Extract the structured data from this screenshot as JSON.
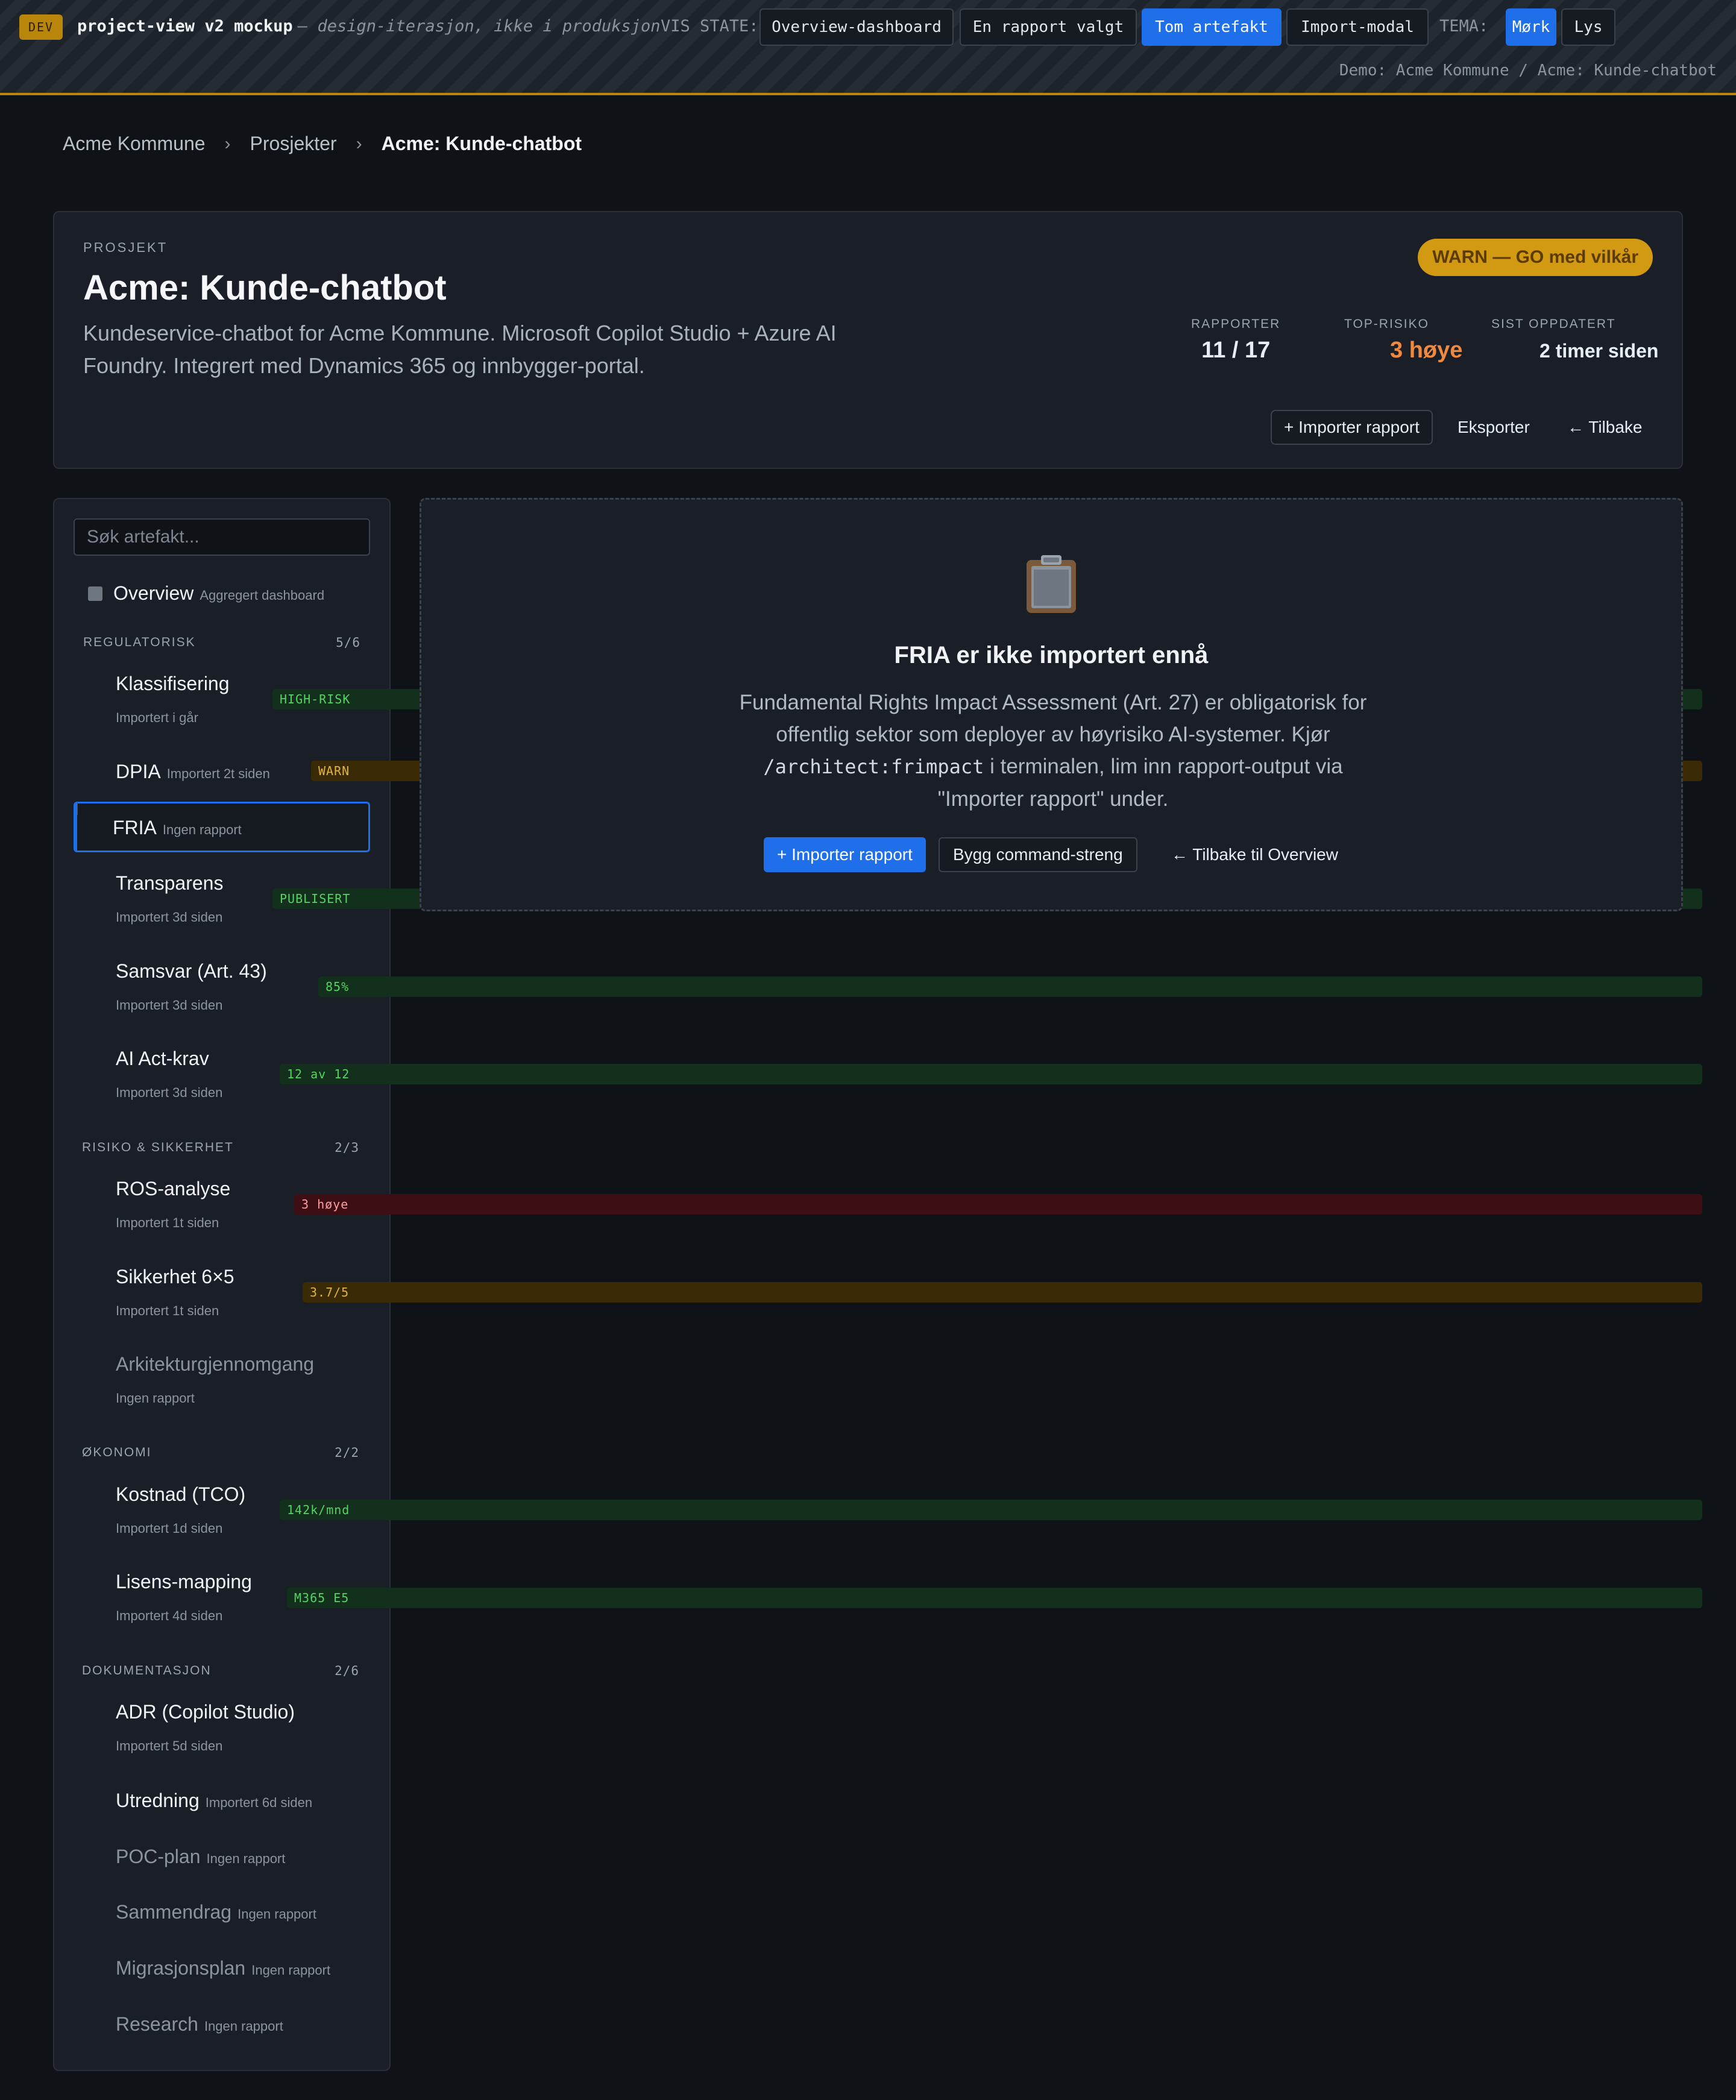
{
  "devbar": {
    "badge": "DEV",
    "title": "project-view v2 mockup",
    "subtitle": "— design-iterasjon, ikke i produksjon",
    "state_label": "VIS STATE:",
    "states": [
      "Overview-dashboard",
      "En rapport valgt",
      "Tom artefakt",
      "Import-modal"
    ],
    "active_state": "Tom artefakt",
    "theme_label": "TEMA:",
    "themes": [
      "Mørk",
      "Lys"
    ],
    "active_theme": "Mørk",
    "demo": "Demo: Acme Kommune / Acme: Kunde-chatbot"
  },
  "breadcrumb": [
    "Acme Kommune",
    "Prosjekter",
    "Acme: Kunde-chatbot"
  ],
  "breadcrumb_sep": "›",
  "project": {
    "eyebrow": "PROSJEKT",
    "title": "Acme: Kunde-chatbot",
    "description": "Kundeservice-chatbot for Acme Kommune. Microsoft Copilot Studio + Azure AI Foundry. Integrert med Dynamics 365 og innbygger-portal.",
    "status": "WARN — GO med vilkår",
    "stats": {
      "reports_label": "RAPPORTER",
      "reports_value": "11 / 17",
      "risk_label": "TOP-RISIKO",
      "risk_value": "3 høye",
      "updated_label": "SIST OPPDATERT",
      "updated_value": "2 timer siden"
    },
    "actions": {
      "import": "+ Importer rapport",
      "export": "Eksporter",
      "back": "← Tilbake"
    }
  },
  "sidebar": {
    "search_placeholder": "Søk artefakt...",
    "overview": {
      "label": "Overview",
      "sub": "Aggregert dashboard"
    },
    "groups": [
      {
        "title": "REGULATORISK",
        "count": "5/6",
        "items": [
          {
            "name": "Klassifisering",
            "sub": "Importert i går",
            "tag": "HIGH-RISK",
            "status": "green"
          },
          {
            "name": "DPIA",
            "sub": "Importert 2t siden",
            "tag": "WARN",
            "status": "yellow"
          },
          {
            "name": "FRIA",
            "sub": "Ingen rapport",
            "tag": "",
            "status": "empty"
          },
          {
            "name": "Transparens",
            "sub": "Importert 3d siden",
            "tag": "PUBLISERT",
            "status": "green"
          },
          {
            "name": "Samsvar (Art. 43)",
            "sub": "Importert 3d siden",
            "tag": "85%",
            "status": "green"
          },
          {
            "name": "AI Act-krav",
            "sub": "Importert 3d siden",
            "tag": "12 av 12",
            "status": "green"
          }
        ]
      },
      {
        "title": "RISIKO & SIKKERHET",
        "count": "2/3",
        "items": [
          {
            "name": "ROS-analyse",
            "sub": "Importert 1t siden",
            "tag": "3 høye",
            "status": "red"
          },
          {
            "name": "Sikkerhet 6×5",
            "sub": "Importert 1t siden",
            "tag": "3.7/5",
            "status": "yellow"
          },
          {
            "name": "Arkitekturgjennomgang",
            "sub": "Ingen rapport",
            "tag": "",
            "status": "empty"
          }
        ]
      },
      {
        "title": "ØKONOMI",
        "count": "2/2",
        "items": [
          {
            "name": "Kostnad (TCO)",
            "sub": "Importert 1d siden",
            "tag": "142k/mnd",
            "status": "green"
          },
          {
            "name": "Lisens-mapping",
            "sub": "Importert 4d siden",
            "tag": "M365 E5",
            "status": "green"
          }
        ]
      },
      {
        "title": "DOKUMENTASJON",
        "count": "2/6",
        "items": [
          {
            "name": "ADR (Copilot Studio)",
            "sub": "Importert 5d siden",
            "tag": "",
            "status": "green"
          },
          {
            "name": "Utredning",
            "sub": "Importert 6d siden",
            "tag": "",
            "status": "yellow"
          },
          {
            "name": "POC-plan",
            "sub": "Ingen rapport",
            "tag": "",
            "status": "empty"
          },
          {
            "name": "Sammendrag",
            "sub": "Ingen rapport",
            "tag": "",
            "status": "empty"
          },
          {
            "name": "Migrasjonsplan",
            "sub": "Ingen rapport",
            "tag": "",
            "status": "empty"
          },
          {
            "name": "Research",
            "sub": "Ingen rapport",
            "tag": "",
            "status": "empty"
          }
        ]
      }
    ]
  },
  "empty_state": {
    "icon": "clipboard-icon",
    "title": "FRIA er ikke importert ennå",
    "desc_before": "Fundamental Rights Impact Assessment (Art. 27) er obligatorisk for offentlig sektor som deployer av høyrisiko AI-systemer. Kjør ",
    "desc_code": "/architect:frimpact",
    "desc_after": " i terminalen, lim inn rapport-output via \"Importer rapport\" under.",
    "buttons": {
      "import": "+ Importer rapport",
      "build": "Bygg command-streng",
      "back": "← Tilbake til Overview"
    }
  },
  "colors": {
    "accent": "#1f6feb",
    "warn": "#d29a12",
    "ok": "#1f883d",
    "danger": "#cf222e",
    "risk_text": "#f0883e"
  }
}
